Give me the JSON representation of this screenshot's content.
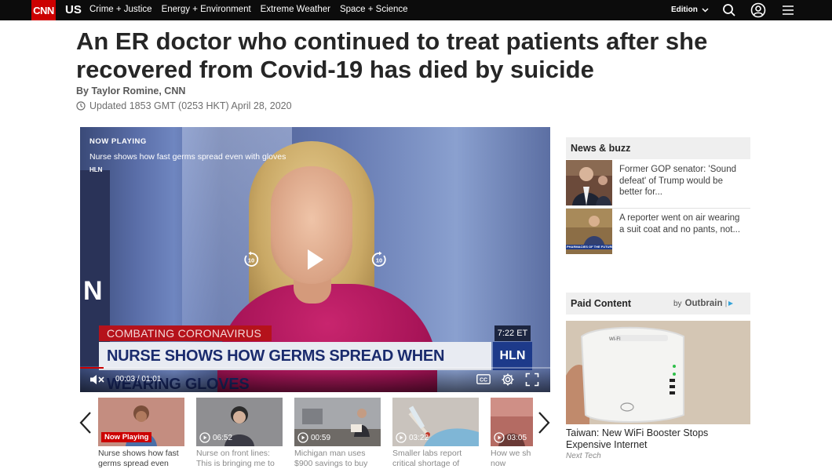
{
  "nav": {
    "logo": "CNN",
    "section": "US",
    "links": [
      "Crime + Justice",
      "Energy + Environment",
      "Extreme Weather",
      "Space + Science"
    ],
    "edition": "Edition"
  },
  "article": {
    "headline": "An ER doctor who continued to treat patients after she recovered from Covid-19 has died by suicide",
    "byline": "By Taylor Romine, CNN",
    "updated": "Updated 1853 GMT (0253 HKT) April 28, 2020"
  },
  "video": {
    "now_playing_label": "NOW PLAYING",
    "title": "Nurse shows how fast germs spread even with gloves",
    "source": "HLN",
    "skip_back_label": "10",
    "skip_fwd_label": "10",
    "lower_third_tag": "COMBATING CORONAVIRUS",
    "lower_third_main": "NURSE SHOWS HOW GERMS SPREAD WHEN WEARING GLOVES",
    "lower_third_time": "7:22 ET",
    "lower_third_network": "HLN",
    "wall_letter": "N",
    "time": "00:03 / 01:01",
    "progress": 0.05
  },
  "sidebar": {
    "news_heading": "News & buzz",
    "news": [
      {
        "text": "Former GOP senator: 'Sound defeat' of Trump would be better for..."
      },
      {
        "text": "A reporter went on air wearing a suit coat and no pants, not..."
      }
    ],
    "news_thumb_caption": "PHARMACIES OF THE FUTURE",
    "paid_heading": "Paid Content",
    "paid_by": "by",
    "paid_brand": "Outbrain",
    "paid_title": "Taiwan: New WiFi Booster Stops Expensive Internet",
    "paid_source": "Next Tech",
    "paid_device_label": "WI-FI"
  },
  "carousel": {
    "items": [
      {
        "badge": "Now Playing",
        "caption": "Nurse shows how fast germs spread even"
      },
      {
        "duration": "06:52",
        "caption": "Nurse on front lines: This is bringing me to"
      },
      {
        "duration": "00:59",
        "caption": "Michigan man uses $900 savings to buy"
      },
      {
        "duration": "03:22",
        "caption": "Smaller labs report critical shortage of"
      },
      {
        "duration": "03:05",
        "caption": "How we sh now"
      }
    ]
  },
  "colors": {
    "brand_red": "#cc0000",
    "nav_bg": "#0c0c0c"
  }
}
